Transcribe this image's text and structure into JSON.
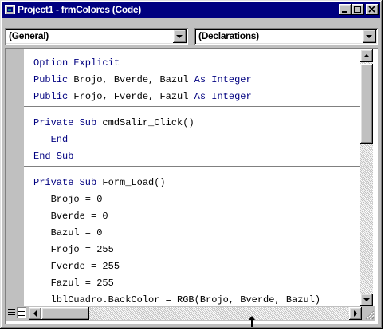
{
  "window": {
    "title": "Project1 - frmColores (Code)"
  },
  "combos": {
    "object": "(General)",
    "procedure": "(Declarations)"
  },
  "code": {
    "blocks": [
      [
        [
          {
            "k": true,
            "t": "Option Explicit"
          }
        ],
        [
          {
            "k": true,
            "t": "Public"
          },
          {
            "k": false,
            "t": " Brojo, Bverde, Bazul "
          },
          {
            "k": true,
            "t": "As Integer"
          }
        ],
        [
          {
            "k": true,
            "t": "Public"
          },
          {
            "k": false,
            "t": " Frojo, Fverde, Fazul "
          },
          {
            "k": true,
            "t": "As Integer"
          }
        ]
      ],
      [
        [
          {
            "k": true,
            "t": "Private Sub"
          },
          {
            "k": false,
            "t": " cmdSalir_Click()"
          }
        ],
        [
          {
            "k": true,
            "t": "   End"
          }
        ],
        [
          {
            "k": true,
            "t": "End Sub"
          }
        ]
      ],
      [
        [
          {
            "k": true,
            "t": "Private Sub"
          },
          {
            "k": false,
            "t": " Form_Load()"
          }
        ],
        [
          {
            "k": false,
            "t": "   Brojo = 0"
          }
        ],
        [
          {
            "k": false,
            "t": "   Bverde = 0"
          }
        ],
        [
          {
            "k": false,
            "t": "   Bazul = 0"
          }
        ],
        [
          {
            "k": false,
            "t": "   Frojo = 255"
          }
        ],
        [
          {
            "k": false,
            "t": "   Fverde = 255"
          }
        ],
        [
          {
            "k": false,
            "t": "   Fazul = 255"
          }
        ],
        [
          {
            "k": false,
            "t": "   lblCuadro.BackColor = RGB(Brojo, Bverde, Bazul)"
          }
        ]
      ]
    ]
  },
  "colors": {
    "titlebar": "#000080",
    "keyword": "#000080",
    "face": "#c0c0c0"
  },
  "icons": {
    "title": "vb-code-window-icon",
    "minimize": "minimize-icon",
    "maximize": "maximize-icon",
    "close": "close-icon",
    "dropdown": "chevron-down-icon",
    "scroll_up": "arrow-up-icon",
    "scroll_down": "arrow-down-icon",
    "scroll_left": "arrow-left-icon",
    "scroll_right": "arrow-right-icon",
    "procedure_view": "procedure-view-icon",
    "full_module_view": "full-module-view-icon",
    "resize": "resize-grip-icon"
  }
}
